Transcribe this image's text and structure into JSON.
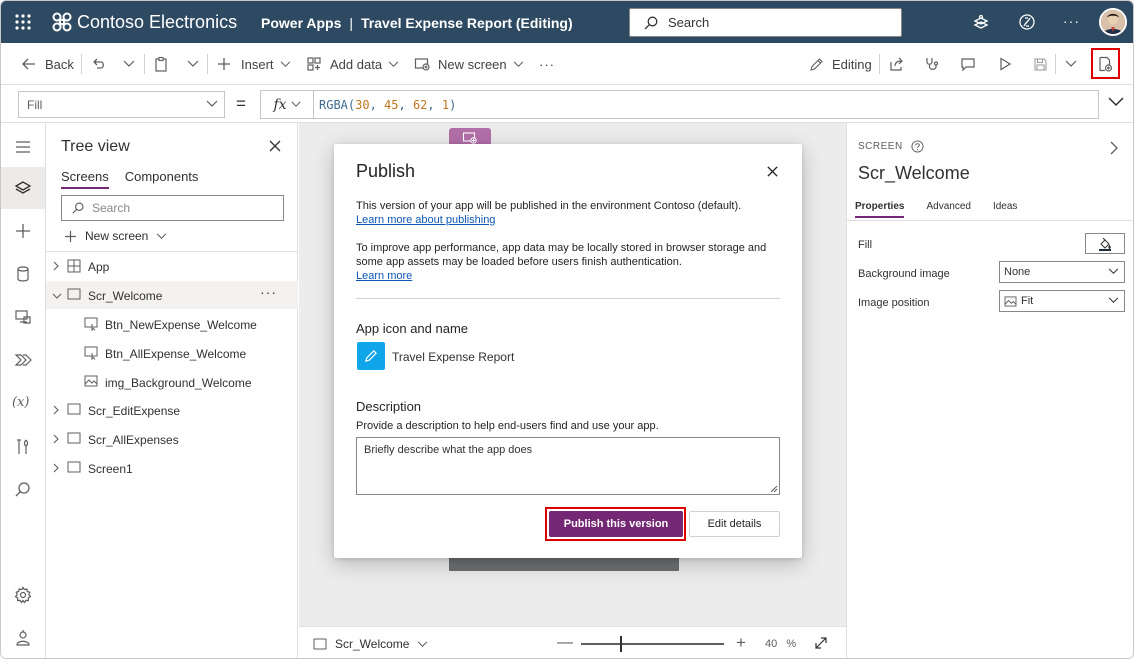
{
  "header": {
    "brand": "Contoso Electronics",
    "product": "Power Apps",
    "separator": "|",
    "app_title": "Travel Expense Report (Editing)",
    "search_placeholder": "Search",
    "more": "···"
  },
  "commandbar": {
    "back": "Back",
    "insert": "Insert",
    "add_data": "Add data",
    "new_screen": "New screen",
    "more": "···",
    "editing": "Editing"
  },
  "formula": {
    "property": "Fill",
    "equals": "=",
    "fx": "fx",
    "func": "RGBA(",
    "args": [
      "30",
      "45",
      "62",
      "1"
    ],
    "close": ")"
  },
  "tree": {
    "title": "Tree view",
    "tabs": [
      "Screens",
      "Components"
    ],
    "search_placeholder": "Search",
    "new_screen": "New screen",
    "items": [
      {
        "label": "App"
      },
      {
        "label": "Scr_Welcome"
      },
      {
        "label": "Btn_NewExpense_Welcome"
      },
      {
        "label": "Btn_AllExpense_Welcome"
      },
      {
        "label": "img_Background_Welcome"
      },
      {
        "label": "Scr_EditExpense"
      },
      {
        "label": "Scr_AllExpenses"
      },
      {
        "label": "Screen1"
      }
    ],
    "more": "···"
  },
  "statusbar": {
    "screen": "Scr_Welcome",
    "minus": "—",
    "plus": "+",
    "zoom": "40",
    "zoom_unit": "%",
    "zoom_level": 0.4
  },
  "properties": {
    "caption": "SCREEN",
    "name": "Scr_Welcome",
    "tabs": [
      "Properties",
      "Advanced",
      "Ideas"
    ],
    "fill_label": "Fill",
    "bg_image_label": "Background image",
    "bg_image_value": "None",
    "img_position_label": "Image position",
    "img_position_value": "Fit"
  },
  "modal": {
    "title": "Publish",
    "env_text": "This version of your app will be published in the environment Contoso (default).",
    "learn_publishing": "Learn more about publishing",
    "perf_text": "To improve app performance, app data may be locally stored in browser storage and some app assets may be loaded before users finish authentication.",
    "learn_more": "Learn more",
    "icon_section": "App icon and name",
    "app_name": "Travel Expense Report",
    "desc_section": "Description",
    "desc_help": "Provide a description to help end-users find and use your app.",
    "desc_placeholder": "Briefly describe what the app does",
    "publish_button": "Publish this version",
    "edit_button": "Edit details"
  },
  "colors": {
    "header_bg": "#2e4a62",
    "accent": "#742774",
    "highlight": "#e00000",
    "link": "#0b57b4",
    "app_icon_bg": "#0ea5e9"
  }
}
